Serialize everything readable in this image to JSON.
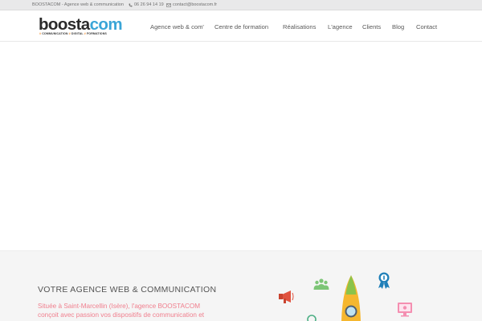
{
  "topbar": {
    "site_label": "BOOSTACOM - Agence web & communication",
    "phone": "06 26 94 14 19",
    "email": "contact@boostacom.fr"
  },
  "logo": {
    "word_part1": "boosta",
    "word_part2": "com",
    "tagline_items": [
      "COMMUNICATION",
      "DIGITAL",
      "FORMATIONS"
    ],
    "tagline_bullet": "#"
  },
  "nav": {
    "items": [
      {
        "label": "Agence web & com'"
      },
      {
        "label": "Centre de formation"
      },
      {
        "label": "Réalisations"
      },
      {
        "label": "L'agence"
      },
      {
        "label": "Clients"
      },
      {
        "label": "Blog"
      },
      {
        "label": "Contact"
      }
    ]
  },
  "section": {
    "title": "VOTRE AGENCE WEB & COMMUNICATION",
    "text": "Située à Saint-Marcellin (Isère), l'agence BOOSTACOM conçoit avec passion vos dispositifs de communication et vous"
  },
  "icons": {
    "phone": "phone-icon",
    "mail": "mail-icon",
    "megaphone": "megaphone-icon",
    "team": "team-icon",
    "rocket": "rocket-icon",
    "award": "award-icon",
    "monitor": "monitor-icon",
    "target": "target-icon"
  },
  "colors": {
    "brand_dark": "#2b2b2b",
    "brand_blue": "#3aa5d7",
    "accent_orange": "#f28a25",
    "text_pink": "#f07e8d",
    "team_green": "#7cc576",
    "award_blue": "#1f7fb8"
  }
}
